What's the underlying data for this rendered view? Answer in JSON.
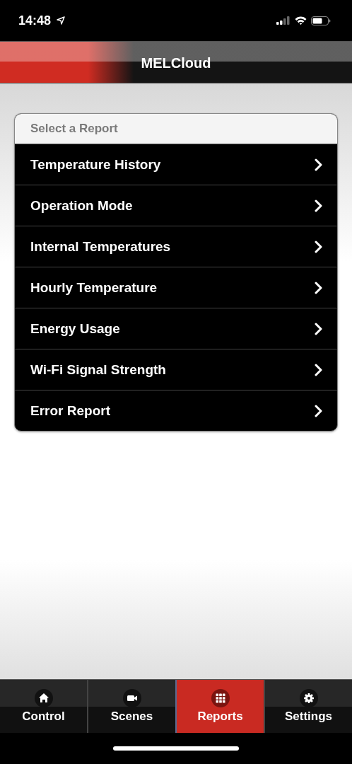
{
  "status_bar": {
    "time": "14:48"
  },
  "header": {
    "title": "MELCloud"
  },
  "report_list": {
    "heading": "Select a Report",
    "items": [
      {
        "label": "Temperature History"
      },
      {
        "label": "Operation Mode"
      },
      {
        "label": "Internal Temperatures"
      },
      {
        "label": "Hourly Temperature"
      },
      {
        "label": "Energy Usage"
      },
      {
        "label": "Wi-Fi Signal Strength"
      },
      {
        "label": "Error Report"
      }
    ]
  },
  "tabs": [
    {
      "label": "Control",
      "kind": "home",
      "selected": false
    },
    {
      "label": "Scenes",
      "kind": "camera",
      "selected": false
    },
    {
      "label": "Reports",
      "kind": "grid",
      "selected": true
    },
    {
      "label": "Settings",
      "kind": "gear",
      "selected": false
    }
  ]
}
